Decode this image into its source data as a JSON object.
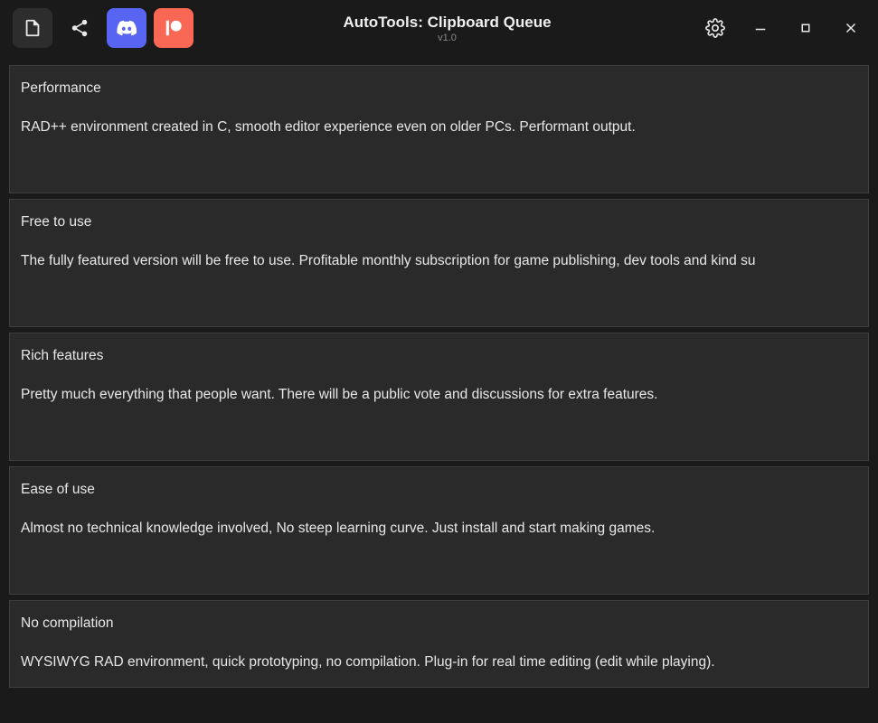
{
  "header": {
    "title": "AutoTools: Clipboard Queue",
    "version": "v1.0"
  },
  "cards": [
    {
      "title": "Performance",
      "body": "RAD++ environment created in C, smooth editor experience even on older PCs. Performant output."
    },
    {
      "title": "Free to use",
      "body": "The fully featured version will be free to use. Profitable monthly subscription for game publishing, dev tools and kind su"
    },
    {
      "title": "Rich features",
      "body": "Pretty much everything that people want. There will be a public vote and discussions for extra features."
    },
    {
      "title": "Ease of use",
      "body": "Almost no technical knowledge involved, No steep learning curve. Just install and start making games."
    },
    {
      "title": "No compilation",
      "body": "WYSIWYG RAD environment, quick prototyping, no compilation. Plug-in for real time editing (edit while playing)."
    }
  ]
}
